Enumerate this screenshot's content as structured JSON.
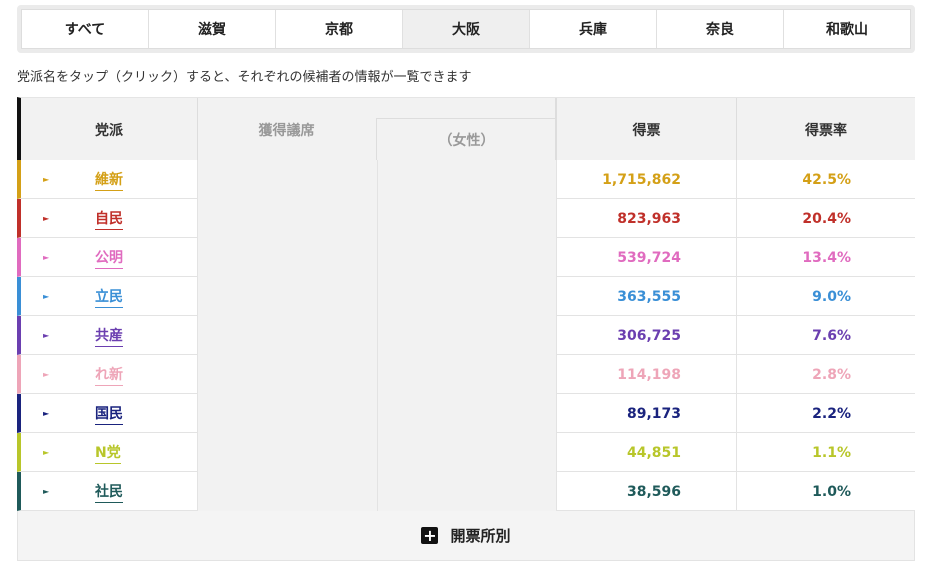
{
  "tabs": [
    {
      "label": "すべて",
      "active": false
    },
    {
      "label": "滋賀",
      "active": false
    },
    {
      "label": "京都",
      "active": false
    },
    {
      "label": "大阪",
      "active": true
    },
    {
      "label": "兵庫",
      "active": false
    },
    {
      "label": "奈良",
      "active": false
    },
    {
      "label": "和歌山",
      "active": false
    }
  ],
  "hint": "党派名をタップ（クリック）すると、それぞれの候補者の情報が一覧できます",
  "header": {
    "party": "党派",
    "seats": "獲得議席",
    "women": "（女性）",
    "votes": "得票",
    "rate": "得票率"
  },
  "rows": [
    {
      "party": "維新",
      "votes": "1,715,862",
      "rate": "42.5%",
      "color": "#d4a017"
    },
    {
      "party": "自民",
      "votes": "823,963",
      "rate": "20.4%",
      "color": "#c0302a"
    },
    {
      "party": "公明",
      "votes": "539,724",
      "rate": "13.4%",
      "color": "#e06bbf"
    },
    {
      "party": "立民",
      "votes": "363,555",
      "rate": "9.0%",
      "color": "#3a8fd6"
    },
    {
      "party": "共産",
      "votes": "306,725",
      "rate": "7.6%",
      "color": "#6b3fb0"
    },
    {
      "party": "れ新",
      "votes": "114,198",
      "rate": "2.8%",
      "color": "#eea5b8"
    },
    {
      "party": "国民",
      "votes": "89,173",
      "rate": "2.2%",
      "color": "#1a237e"
    },
    {
      "party": "N党",
      "votes": "44,851",
      "rate": "1.1%",
      "color": "#b8c62a"
    },
    {
      "party": "社民",
      "votes": "38,596",
      "rate": "1.0%",
      "color": "#1f5a5a"
    }
  ],
  "footer": {
    "label": "開票所別",
    "icon": "plus-icon"
  }
}
